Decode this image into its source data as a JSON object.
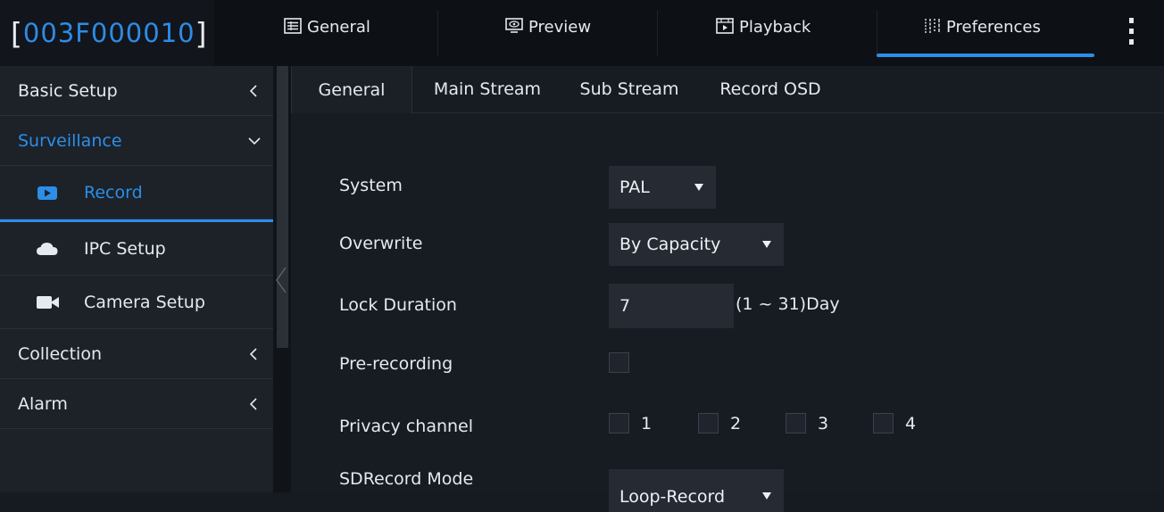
{
  "header": {
    "device_id": "003F000010",
    "bracket_open": "[",
    "bracket_close": "]",
    "tabs": [
      {
        "label": "General",
        "icon": "general-icon"
      },
      {
        "label": "Preview",
        "icon": "preview-icon"
      },
      {
        "label": "Playback",
        "icon": "playback-icon"
      },
      {
        "label": "Preferences",
        "icon": "preferences-icon",
        "active": true
      }
    ],
    "more_icon": "more-vertical-icon"
  },
  "sidebar": {
    "items": [
      {
        "label": "Basic Setup",
        "expanded": false
      },
      {
        "label": "Surveillance",
        "expanded": true,
        "children": [
          {
            "label": "Record",
            "icon": "record-icon",
            "active": true
          },
          {
            "label": "IPC Setup",
            "icon": "cloud-icon"
          },
          {
            "label": "Camera Setup",
            "icon": "camera-icon"
          }
        ]
      },
      {
        "label": "Collection",
        "expanded": false
      },
      {
        "label": "Alarm",
        "expanded": false
      }
    ]
  },
  "subtabs": [
    {
      "label": "General",
      "active": true
    },
    {
      "label": "Main Stream"
    },
    {
      "label": "Sub Stream"
    },
    {
      "label": "Record OSD"
    }
  ],
  "form": {
    "system": {
      "label": "System",
      "value": "PAL"
    },
    "overwrite": {
      "label": "Overwrite",
      "value": "By Capacity"
    },
    "lock_duration": {
      "label": "Lock Duration",
      "value": "7",
      "range": "(1 ~ 31)Day"
    },
    "pre_recording": {
      "label": "Pre-recording",
      "checked": false
    },
    "privacy_channel": {
      "label": "Privacy channel",
      "channels": [
        "1",
        "2",
        "3",
        "4"
      ]
    },
    "sdrecord_mode": {
      "label": "SDRecord Mode",
      "value": "Loop-Record"
    }
  },
  "colors": {
    "accent": "#2b8fe8",
    "device_id": "#2d8ce6",
    "background": "#161a21",
    "sidebar": "#1d2128"
  }
}
